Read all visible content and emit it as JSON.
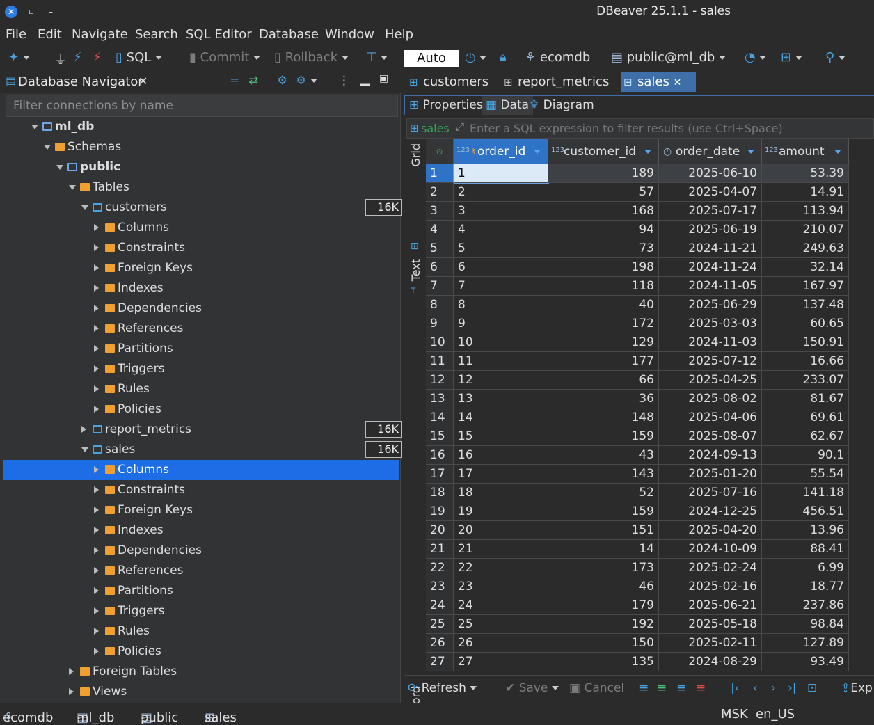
{
  "window": {
    "title": "DBeaver 25.1.1 - sales"
  },
  "menu": [
    "File",
    "Edit",
    "Navigate",
    "Search",
    "SQL Editor",
    "Database",
    "Window",
    "Help"
  ],
  "toolbar": {
    "sql": "SQL",
    "commit": "Commit",
    "rollback": "Rollback",
    "mode": "Auto",
    "connection": "ecomdb",
    "schema": "public@ml_db"
  },
  "navigator": {
    "title": "Database Navigator",
    "filter_placeholder": "Filter connections by name",
    "tree": [
      {
        "label": "ml_db",
        "level": 0,
        "exp": "down",
        "icon": "db-icon",
        "bold": true
      },
      {
        "label": "Schemas",
        "level": 1,
        "exp": "down",
        "icon": "folder-icon"
      },
      {
        "label": "public",
        "level": 2,
        "exp": "down",
        "icon": "schema-icon",
        "bold": true
      },
      {
        "label": "Tables",
        "level": 3,
        "exp": "down",
        "icon": "folder-icon"
      },
      {
        "label": "customers",
        "level": 4,
        "exp": "down",
        "icon": "table-icon",
        "badge": "16K"
      },
      {
        "label": "Columns",
        "level": 5,
        "exp": "right",
        "icon": "folder-icon"
      },
      {
        "label": "Constraints",
        "level": 5,
        "exp": "right",
        "icon": "folder-icon"
      },
      {
        "label": "Foreign Keys",
        "level": 5,
        "exp": "right",
        "icon": "folder-icon"
      },
      {
        "label": "Indexes",
        "level": 5,
        "exp": "right",
        "icon": "folder-icon"
      },
      {
        "label": "Dependencies",
        "level": 5,
        "exp": "right",
        "icon": "folder-icon"
      },
      {
        "label": "References",
        "level": 5,
        "exp": "right",
        "icon": "folder-icon"
      },
      {
        "label": "Partitions",
        "level": 5,
        "exp": "right",
        "icon": "folder-icon"
      },
      {
        "label": "Triggers",
        "level": 5,
        "exp": "right",
        "icon": "folder-icon"
      },
      {
        "label": "Rules",
        "level": 5,
        "exp": "right",
        "icon": "folder-icon"
      },
      {
        "label": "Policies",
        "level": 5,
        "exp": "right",
        "icon": "folder-icon"
      },
      {
        "label": "report_metrics",
        "level": 4,
        "exp": "right",
        "icon": "table-icon",
        "badge": "16K"
      },
      {
        "label": "sales",
        "level": 4,
        "exp": "down",
        "icon": "table-icon",
        "badge": "16K"
      },
      {
        "label": "Columns",
        "level": 5,
        "exp": "right",
        "icon": "folder-icon",
        "selected": true
      },
      {
        "label": "Constraints",
        "level": 5,
        "exp": "right",
        "icon": "folder-icon"
      },
      {
        "label": "Foreign Keys",
        "level": 5,
        "exp": "right",
        "icon": "folder-icon"
      },
      {
        "label": "Indexes",
        "level": 5,
        "exp": "right",
        "icon": "folder-icon"
      },
      {
        "label": "Dependencies",
        "level": 5,
        "exp": "right",
        "icon": "folder-icon"
      },
      {
        "label": "References",
        "level": 5,
        "exp": "right",
        "icon": "folder-icon"
      },
      {
        "label": "Partitions",
        "level": 5,
        "exp": "right",
        "icon": "folder-icon"
      },
      {
        "label": "Triggers",
        "level": 5,
        "exp": "right",
        "icon": "folder-icon"
      },
      {
        "label": "Rules",
        "level": 5,
        "exp": "right",
        "icon": "folder-icon"
      },
      {
        "label": "Policies",
        "level": 5,
        "exp": "right",
        "icon": "folder-icon"
      },
      {
        "label": "Foreign Tables",
        "level": 3,
        "exp": "right",
        "icon": "folder-icon"
      },
      {
        "label": "Views",
        "level": 3,
        "exp": "right",
        "icon": "folder-icon"
      }
    ]
  },
  "editor": {
    "tabs": [
      "customers",
      "report_metrics",
      "sales"
    ],
    "active_tab": "sales",
    "subtabs": [
      "Properties",
      "Data",
      "Diagram"
    ],
    "filter_table": "sales",
    "filter_placeholder": "Enter a SQL expression to filter results (use Ctrl+Space)",
    "side": {
      "grid": "Grid",
      "text": "Text",
      "record": "Record"
    },
    "columns": [
      "order_id",
      "customer_id",
      "order_date",
      "amount"
    ],
    "rows": [
      [
        "1",
        "1",
        "189",
        "2025-06-10",
        "53.39"
      ],
      [
        "2",
        "2",
        "57",
        "2025-04-07",
        "14.91"
      ],
      [
        "3",
        "3",
        "168",
        "2025-07-17",
        "113.94"
      ],
      [
        "4",
        "4",
        "94",
        "2025-06-19",
        "210.07"
      ],
      [
        "5",
        "5",
        "73",
        "2024-11-21",
        "249.63"
      ],
      [
        "6",
        "6",
        "198",
        "2024-11-24",
        "32.14"
      ],
      [
        "7",
        "7",
        "118",
        "2024-11-05",
        "167.97"
      ],
      [
        "8",
        "8",
        "40",
        "2025-06-29",
        "137.48"
      ],
      [
        "9",
        "9",
        "172",
        "2025-03-03",
        "60.65"
      ],
      [
        "10",
        "10",
        "129",
        "2024-11-03",
        "150.91"
      ],
      [
        "11",
        "11",
        "177",
        "2025-07-12",
        "16.66"
      ],
      [
        "12",
        "12",
        "66",
        "2025-04-25",
        "233.07"
      ],
      [
        "13",
        "13",
        "36",
        "2025-08-02",
        "81.67"
      ],
      [
        "14",
        "14",
        "148",
        "2025-04-06",
        "69.61"
      ],
      [
        "15",
        "15",
        "159",
        "2025-08-07",
        "62.67"
      ],
      [
        "16",
        "16",
        "43",
        "2024-09-13",
        "90.1"
      ],
      [
        "17",
        "17",
        "143",
        "2025-01-20",
        "55.54"
      ],
      [
        "18",
        "18",
        "52",
        "2025-07-16",
        "141.18"
      ],
      [
        "19",
        "19",
        "159",
        "2024-12-25",
        "456.51"
      ],
      [
        "20",
        "20",
        "151",
        "2025-04-20",
        "13.96"
      ],
      [
        "21",
        "21",
        "14",
        "2024-10-09",
        "88.41"
      ],
      [
        "22",
        "22",
        "173",
        "2025-02-24",
        "6.99"
      ],
      [
        "23",
        "23",
        "46",
        "2025-02-16",
        "18.77"
      ],
      [
        "24",
        "24",
        "179",
        "2025-06-21",
        "237.86"
      ],
      [
        "25",
        "25",
        "192",
        "2025-05-18",
        "98.84"
      ],
      [
        "26",
        "26",
        "150",
        "2025-02-11",
        "127.89"
      ],
      [
        "27",
        "27",
        "135",
        "2024-08-29",
        "93.49"
      ]
    ],
    "bottom": {
      "refresh": "Refresh",
      "save": "Save",
      "cancel": "Cancel",
      "export": "Exp"
    }
  },
  "status": {
    "crumbs": [
      "ecomdb",
      "ml_db",
      "public",
      "sales"
    ],
    "tz": "MSK",
    "locale": "en_US"
  },
  "colors": {
    "accent": "#1d6ee6",
    "tab_active": "#3e6fa8",
    "folder": "#f0a030"
  }
}
